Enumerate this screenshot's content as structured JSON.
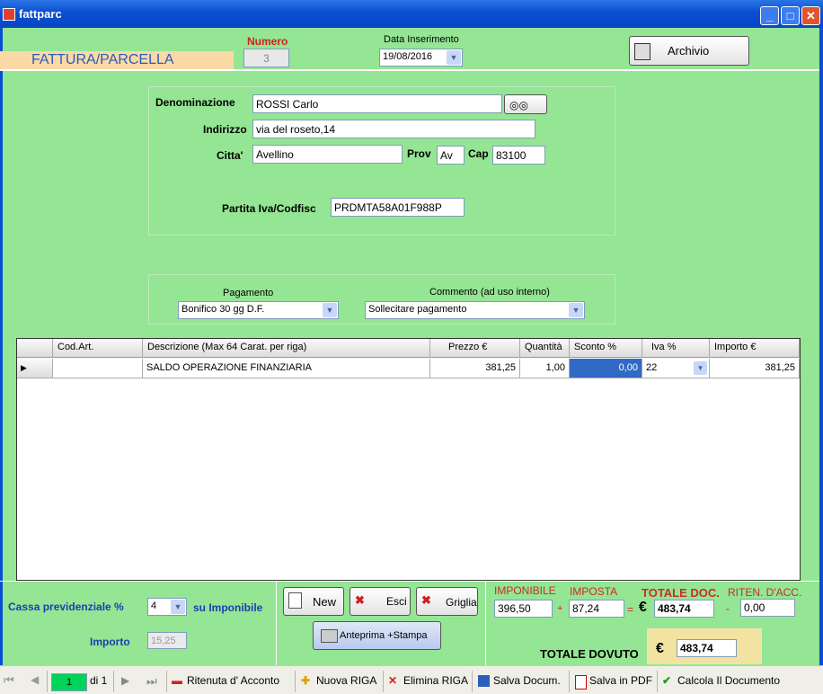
{
  "window": {
    "title": "fattparc"
  },
  "header": {
    "doc_type": "FATTURA/PARCELLA",
    "numero_label": "Numero",
    "numero_value": "3",
    "data_label": "Data Inserimento",
    "data_value": "19/08/2016",
    "archivio_label": "Archivio"
  },
  "cliente": {
    "denominazione_label": "Denominazione",
    "denominazione_value": "ROSSI Carlo",
    "indirizzo_label": "Indirizzo",
    "indirizzo_value": "via del roseto,14",
    "citta_label": "Citta'",
    "citta_value": "Avellino",
    "prov_label": "Prov",
    "prov_value": "Av",
    "cap_label": "Cap",
    "cap_value": "83100",
    "piva_label": "Partita Iva/Codfisc",
    "piva_value": "PRDMTA58A01F988P"
  },
  "pagamento": {
    "label": "Pagamento",
    "value": "Bonifico 30 gg D.F.",
    "commento_label": "Commento (ad uso interno)",
    "commento_value": "Sollecitare pagamento"
  },
  "grid": {
    "columns": [
      "Cod.Art.",
      "Descrizione (Max 64 Carat. per riga)",
      "Prezzo  €",
      "Quantità",
      "Sconto %",
      "Iva  %",
      "Importo €"
    ],
    "rows": [
      {
        "cod": "",
        "descrizione": "SALDO OPERAZIONE FINANZIARIA",
        "prezzo": "381,25",
        "quantita": "1,00",
        "sconto": "0,00",
        "iva": "22",
        "importo": "381,25"
      }
    ]
  },
  "cassa": {
    "label": "Cassa previdenziale %",
    "value": "4",
    "su_label": "su Imponibile",
    "importo_label": "Importo",
    "importo_value": "15,25"
  },
  "buttons": {
    "new": "New",
    "esci": "Esci",
    "griglia": "Griglia",
    "anteprima": "Anteprima +Stampa"
  },
  "totali": {
    "imponibile_label": "IMPONIBILE",
    "imponibile_value": "396,50",
    "imposta_label": "IMPOSTA",
    "imposta_value": "87,24",
    "plus": "+",
    "equals": "=",
    "euro": "€",
    "totale_doc_label": "TOTALE DOC.",
    "totale_doc_value": "483,74",
    "ritenuta_label": "RITEN. D'ACC.",
    "minus": "-",
    "ritenuta_value": "0,00",
    "totale_dovuto_label": "TOTALE DOVUTO",
    "totale_dovuto_value": "483,74"
  },
  "statusbar": {
    "page_value": "1",
    "page_of": "di 1",
    "ritenuta": "Ritenuta d' Acconto",
    "nuova_riga": "Nuova RIGA",
    "elimina_riga": "Elimina RIGA",
    "salva_doc": "Salva Docum.",
    "salva_pdf": "Salva in PDF",
    "calcola": "Calcola Il Documento"
  },
  "colors": {
    "background": "#94e594",
    "titlebar": "#0a4fd1",
    "accent_red": "#cc2a2a",
    "label_blue": "#1c3fb0",
    "selected_cell": "#316ac5"
  }
}
